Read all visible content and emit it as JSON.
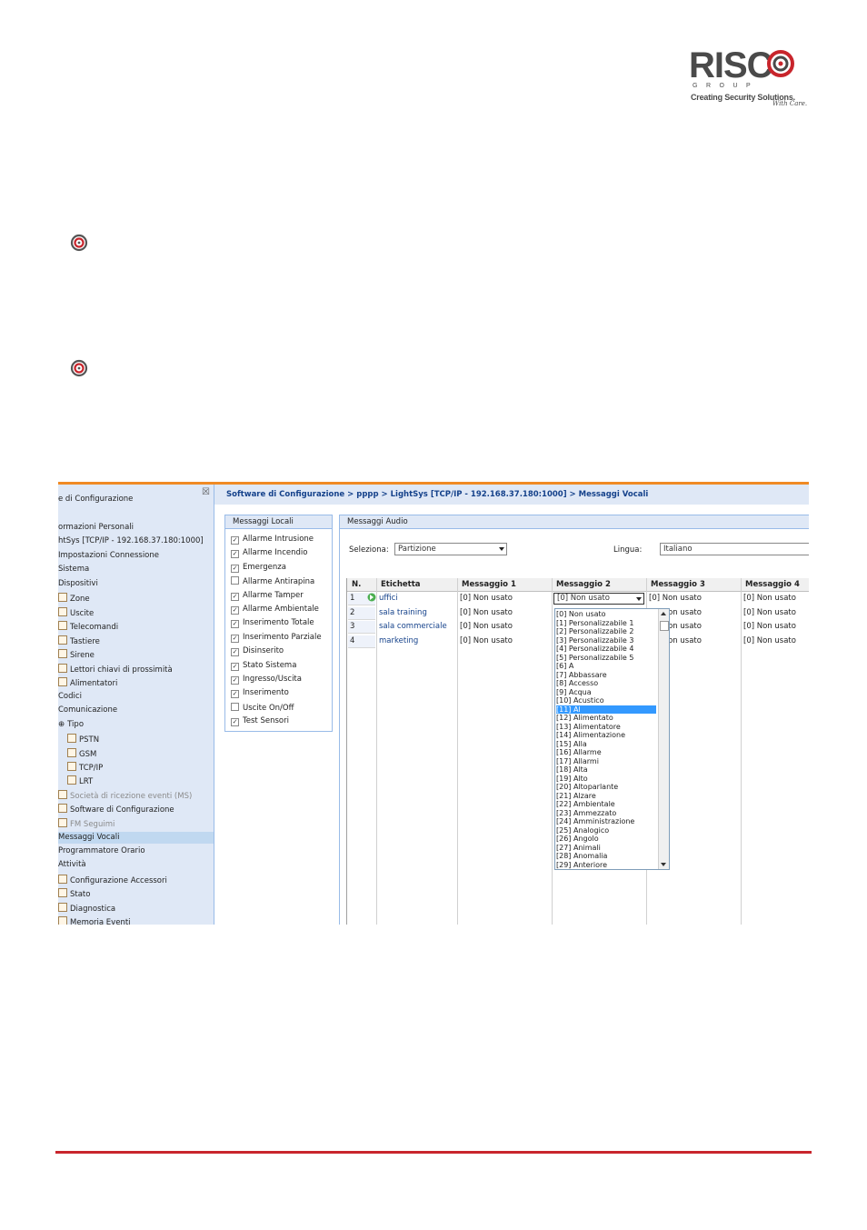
{
  "logo": {
    "word": "RISC",
    "group": "GROUP",
    "tagline": "Creating Security Solutions.",
    "script": "With Care."
  },
  "icons": [
    "risco-bullet-icon",
    "risco-bullet-icon"
  ],
  "colors": {
    "footer_line": "#c8252c",
    "accent_orange": "#f08a24",
    "link_blue": "#15428b",
    "highlight": "#3399ff"
  },
  "screenshot": {
    "breadcrumb": "Software di Configurazione > pppp > LightSys [TCP/IP - 192.168.37.180:1000] > Messaggi Vocali",
    "sidebar": {
      "items": [
        {
          "label": "e di Configurazione",
          "indent": 0,
          "check": false,
          "grey": false
        },
        {
          "label": "ormazioni Personali",
          "indent": 0,
          "check": false,
          "grey": false
        },
        {
          "label": "htSys [TCP/IP - 192.168.37.180:1000]",
          "indent": 0,
          "check": false,
          "grey": false
        },
        {
          "label": "Impostazioni Connessione",
          "indent": 0,
          "check": false,
          "grey": false
        },
        {
          "label": "Sistema",
          "indent": 0,
          "check": false,
          "grey": false
        },
        {
          "label": "Dispositivi",
          "indent": 0,
          "check": false,
          "grey": false
        },
        {
          "label": "Zone",
          "indent": 1,
          "check": true,
          "grey": false
        },
        {
          "label": "Uscite",
          "indent": 1,
          "check": true,
          "grey": false
        },
        {
          "label": "Telecomandi",
          "indent": 1,
          "check": true,
          "grey": false
        },
        {
          "label": "Tastiere",
          "indent": 1,
          "check": true,
          "grey": false
        },
        {
          "label": "Sirene",
          "indent": 1,
          "check": true,
          "grey": false
        },
        {
          "label": "Lettori chiavi di prossimità",
          "indent": 1,
          "check": true,
          "grey": false
        },
        {
          "label": "Alimentatori",
          "indent": 1,
          "check": true,
          "grey": false
        },
        {
          "label": "Codici",
          "indent": 0,
          "check": false,
          "grey": false
        },
        {
          "label": "Comunicazione",
          "indent": 0,
          "check": false,
          "grey": false
        },
        {
          "label": "Tipo",
          "indent": 1,
          "check": false,
          "grey": false,
          "expander": true
        },
        {
          "label": "PSTN",
          "indent": 2,
          "check": true,
          "grey": false
        },
        {
          "label": "GSM",
          "indent": 2,
          "check": true,
          "grey": false
        },
        {
          "label": "TCP/IP",
          "indent": 2,
          "check": true,
          "grey": false
        },
        {
          "label": "LRT",
          "indent": 2,
          "check": true,
          "grey": false
        },
        {
          "label": "Società di ricezione eventi (MS)",
          "indent": 1,
          "check": true,
          "grey": true
        },
        {
          "label": "Software di Configurazione",
          "indent": 1,
          "check": true,
          "grey": false
        },
        {
          "label": "FM Seguimi",
          "indent": 1,
          "check": true,
          "grey": true
        },
        {
          "label": "Messaggi Vocali",
          "indent": 0,
          "check": false,
          "grey": false,
          "selected": true
        },
        {
          "label": "Programmatore Orario",
          "indent": 0,
          "check": false,
          "grey": false
        },
        {
          "label": "Attività",
          "indent": 0,
          "check": false,
          "grey": false
        },
        {
          "label": "Configurazione Accessori",
          "indent": 1,
          "check": true,
          "grey": false
        },
        {
          "label": "Stato",
          "indent": 1,
          "check": true,
          "grey": false
        },
        {
          "label": "Diagnostica",
          "indent": 1,
          "check": true,
          "grey": false
        },
        {
          "label": "Memoria Eventi",
          "indent": 1,
          "check": true,
          "grey": false
        }
      ]
    },
    "local_messages": {
      "title": "Messaggi Locali",
      "items": [
        {
          "label": "Allarme Intrusione",
          "checked": true
        },
        {
          "label": "Allarme Incendio",
          "checked": true
        },
        {
          "label": "Emergenza",
          "checked": true
        },
        {
          "label": "Allarme Antirapina",
          "checked": false
        },
        {
          "label": "Allarme Tamper",
          "checked": true
        },
        {
          "label": "Allarme Ambientale",
          "checked": true
        },
        {
          "label": "Inserimento Totale",
          "checked": true
        },
        {
          "label": "Inserimento Parziale",
          "checked": true
        },
        {
          "label": "Disinserito",
          "checked": true
        },
        {
          "label": "Stato Sistema",
          "checked": true
        },
        {
          "label": "Ingresso/Uscita",
          "checked": true
        },
        {
          "label": "Inserimento",
          "checked": true
        },
        {
          "label": "Uscite On/Off",
          "checked": false
        },
        {
          "label": "Test Sensori",
          "checked": true
        }
      ]
    },
    "audio": {
      "title": "Messaggi Audio",
      "select_label": "Seleziona:",
      "select_value": "Partizione",
      "lang_label": "Lingua:",
      "lang_value": "Italiano",
      "columns": [
        "N.",
        "Etichetta",
        "Messaggio 1",
        "Messaggio 2",
        "Messaggio 3",
        "Messaggio 4"
      ],
      "rows": [
        {
          "n": "1",
          "label": "uffici",
          "m1": "[0] Non usato",
          "m2": "[0] Non usato",
          "m3": "[0] Non usato",
          "m4": "[0] Non usato"
        },
        {
          "n": "2",
          "label": "sala training",
          "m1": "[0] Non usato",
          "m2": "",
          "m3": "[0] Non usato",
          "m4": "[0] Non usato"
        },
        {
          "n": "3",
          "label": "sala commerciale",
          "m1": "[0] Non usato",
          "m2": "",
          "m3": "[0] Non usato",
          "m4": "[0] Non usato"
        },
        {
          "n": "4",
          "label": "marketing",
          "m1": "[0] Non usato",
          "m2": "",
          "m3": "[0] Non usato",
          "m4": "[0] Non usato"
        }
      ],
      "dropdown_options": [
        "[0] Non usato",
        "[1] Personalizzabile 1",
        "[2] Personalizzabile 2",
        "[3] Personalizzabile 3",
        "[4] Personalizzabile 4",
        "[5] Personalizzabile 5",
        "[6] A",
        "[7] Abbassare",
        "[8] Accesso",
        "[9] Acqua",
        "[10] Acustico",
        "[11] Al",
        "[12] Alimentato",
        "[13] Alimentatore",
        "[14] Alimentazione",
        "[15] Alla",
        "[16] Allarme",
        "[17] Allarmi",
        "[18] Alta",
        "[19] Alto",
        "[20] Altoparlante",
        "[21] Alzare",
        "[22] Ambientale",
        "[23] Ammezzato",
        "[24] Amministrazione",
        "[25] Analogico",
        "[26] Angolo",
        "[27] Animali",
        "[28] Anomalia",
        "[29] Anteriore"
      ],
      "dropdown_highlight": 11
    }
  }
}
